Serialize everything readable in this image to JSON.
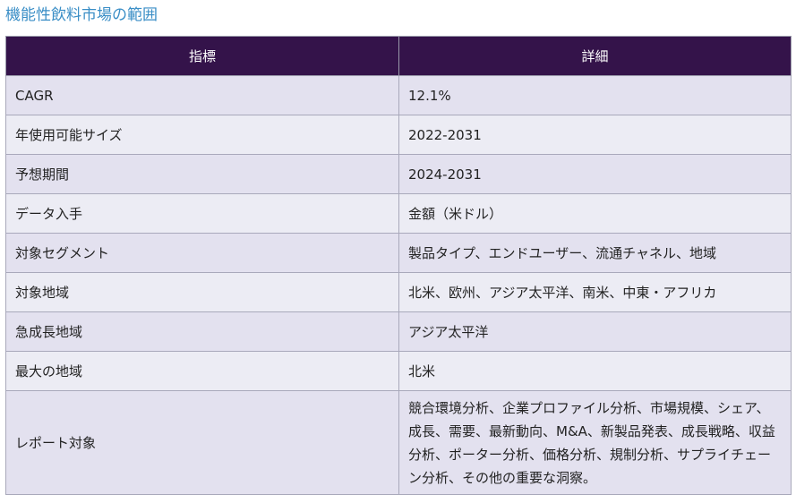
{
  "title": "機能性飲料市場の範囲",
  "table": {
    "headers": [
      "指標",
      "詳細"
    ],
    "rows": [
      {
        "metric": "CAGR",
        "detail": "12.1%"
      },
      {
        "metric": "年使用可能サイズ",
        "detail": "2022-2031"
      },
      {
        "metric": "予想期間",
        "detail": "2024-2031"
      },
      {
        "metric": "データ入手",
        "detail": "金額（米ドル）"
      },
      {
        "metric": "対象セグメント",
        "detail": "製品タイプ、エンドユーザー、流通チャネル、地域"
      },
      {
        "metric": "対象地域",
        "detail": "北米、欧州、アジア太平洋、南米、中東・アフリカ"
      },
      {
        "metric": "急成長地域",
        "detail": "アジア太平洋"
      },
      {
        "metric": "最大の地域",
        "detail": "北米"
      },
      {
        "metric": "レポート対象",
        "detail": "競合環境分析、企業プロファイル分析、市場規模、シェア、成長、需要、最新動向、M&A、新製品発表、成長戦略、収益分析、ポーター分析、価格分析、規制分析、サプライチェーン分析、その他の重要な洞察。"
      }
    ]
  }
}
